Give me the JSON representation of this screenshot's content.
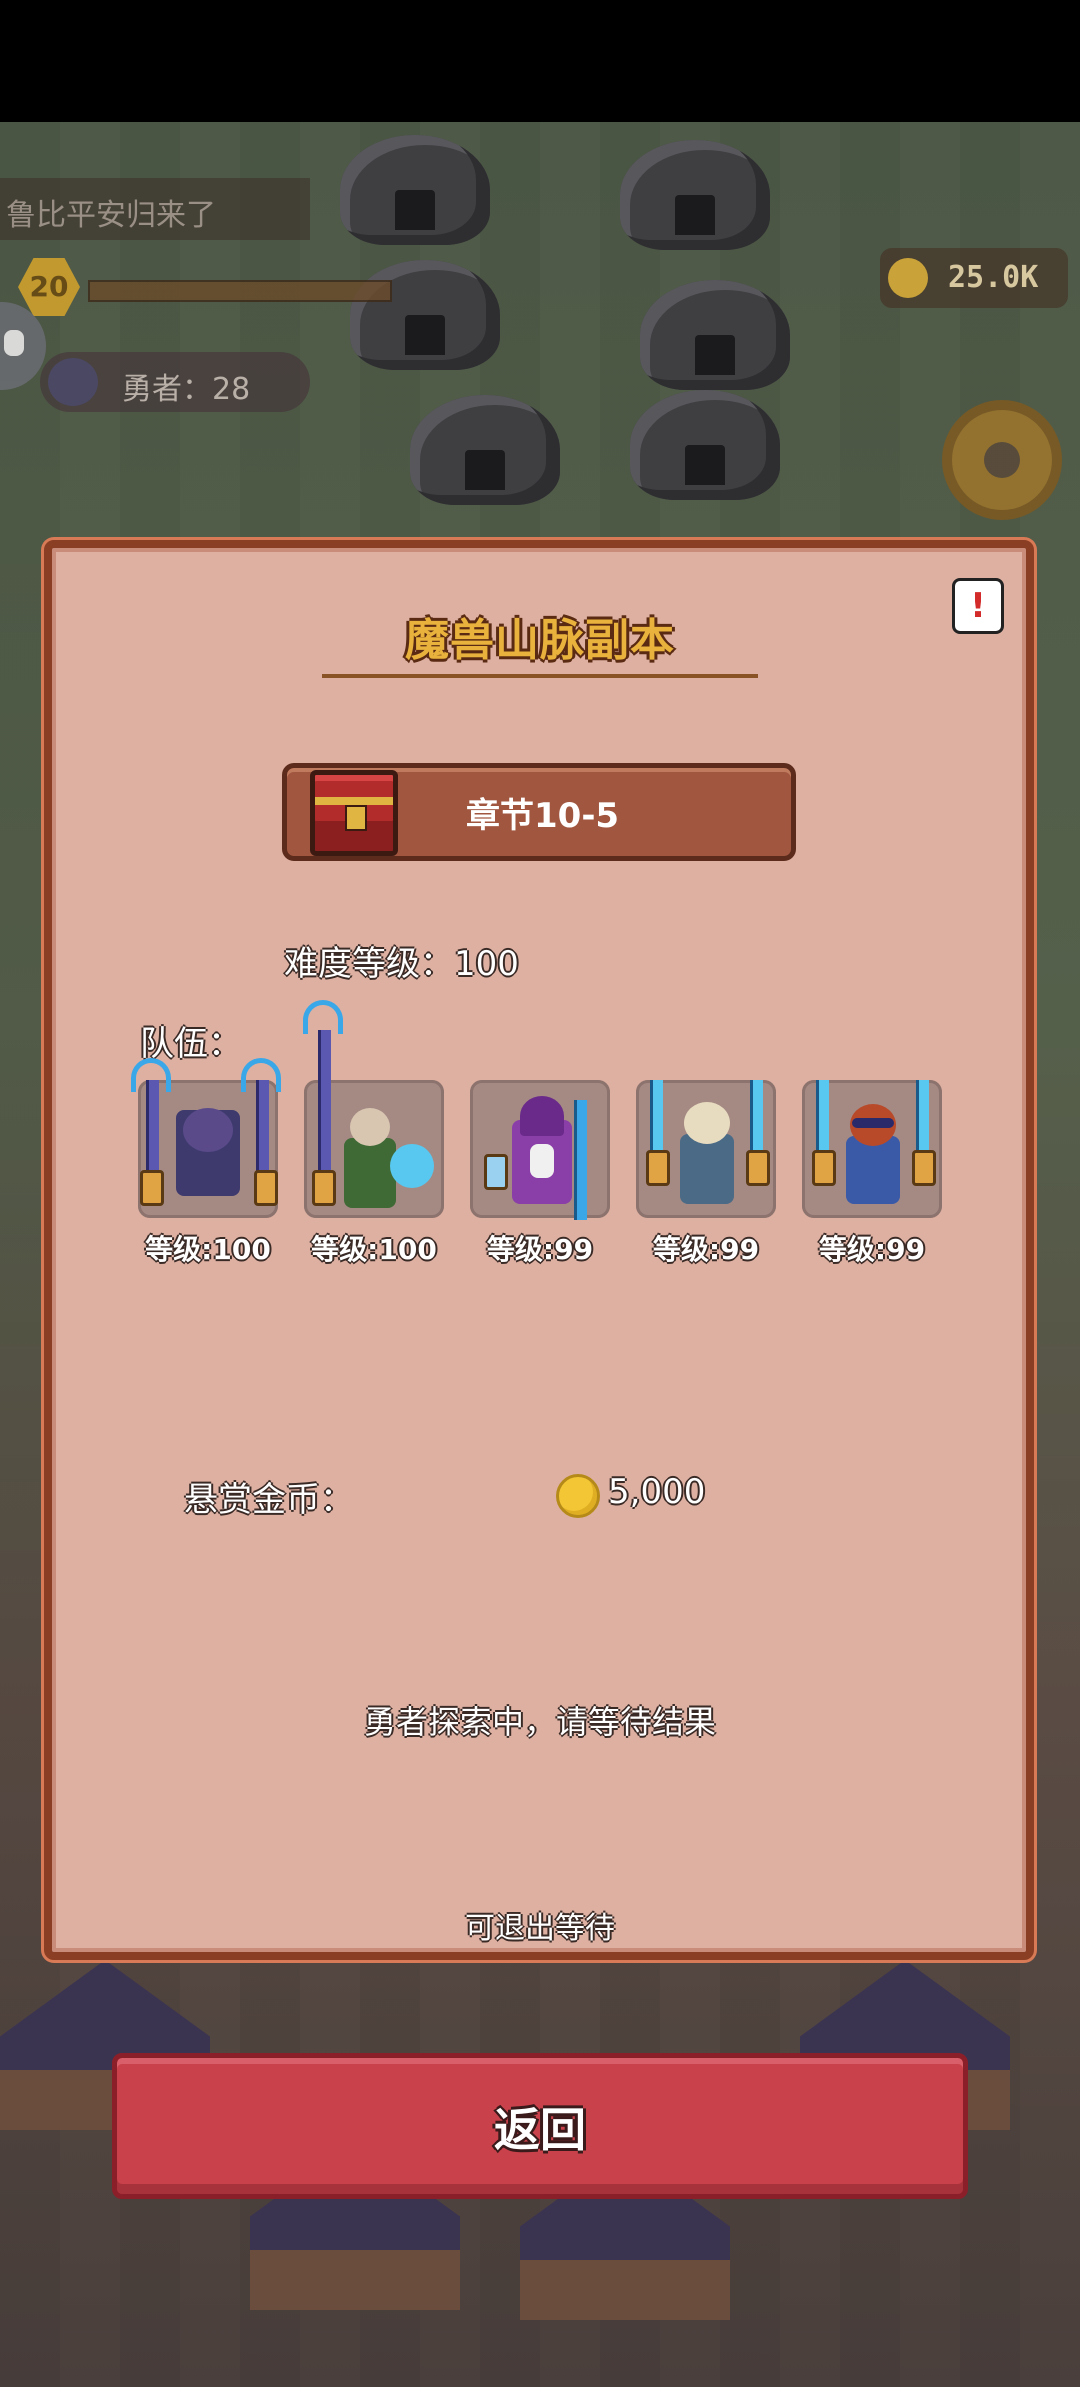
{
  "background": {
    "notice": "鲁比平安归来了",
    "player_level": "20",
    "hero_count_label": "勇者：28",
    "gold_amount": "25.0K"
  },
  "dialog": {
    "title": "魔兽山脉副本",
    "chapter": "章节10-5",
    "difficulty_label": "难度等级：100",
    "team_label": "队伍：",
    "team": [
      {
        "name": "hero-1",
        "level": "等级:100"
      },
      {
        "name": "hero-2",
        "level": "等级:100"
      },
      {
        "name": "hero-3",
        "level": "等级:99"
      },
      {
        "name": "hero-4",
        "level": "等级:99"
      },
      {
        "name": "hero-5",
        "level": "等级:99"
      }
    ],
    "reward_label": "悬赏金币：",
    "reward_amount": "5,000",
    "status": "勇者探索中，请等待结果",
    "hint": "可退出等待"
  },
  "buttons": {
    "return": "返回"
  },
  "icons": {
    "help": "alert-icon",
    "chest": "treasure-chest-icon",
    "coin": "gold-coin-icon",
    "chat": "chat-icon",
    "settings": "gear-icon"
  },
  "colors": {
    "dialog_bg": "#deb0a2",
    "dialog_border": "#8a3e24",
    "title": "#e8b23c",
    "return_button": "#c8414b"
  }
}
